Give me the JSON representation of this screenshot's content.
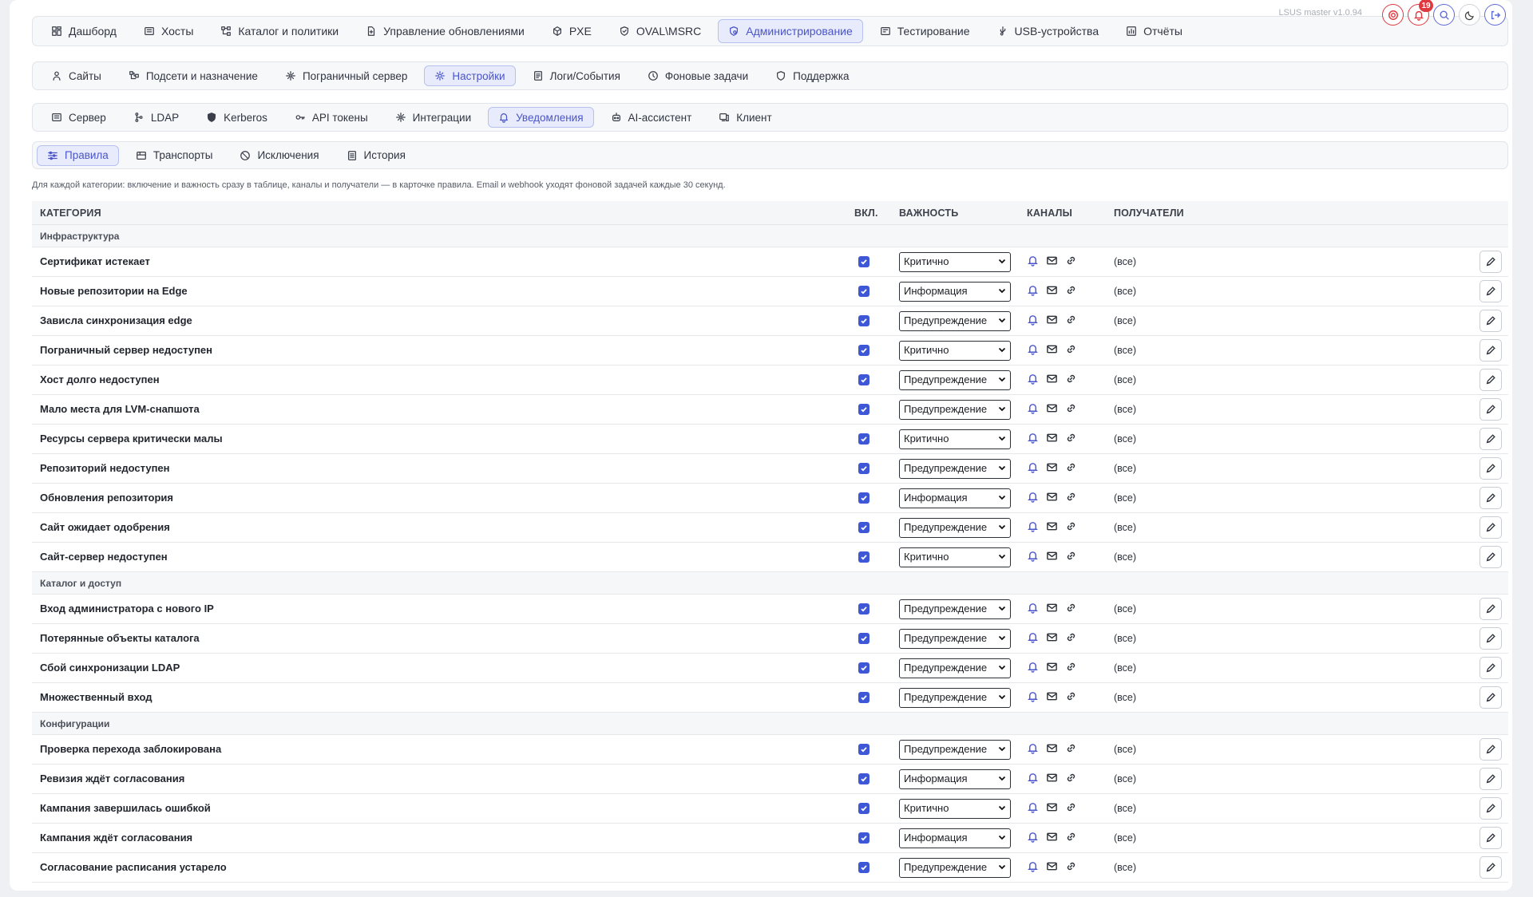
{
  "top_nav": {
    "items": [
      {
        "label": "Дашборд",
        "icon": "dashboard-icon"
      },
      {
        "label": "Хосты",
        "icon": "server-icon"
      },
      {
        "label": "Каталог и политики",
        "icon": "tree-icon"
      },
      {
        "label": "Управление обновлениями",
        "icon": "file-update-icon"
      },
      {
        "label": "PXE",
        "icon": "box-icon"
      },
      {
        "label": "OVAL\\MSRC",
        "icon": "shield-check-icon"
      },
      {
        "label": "Администрирование",
        "icon": "admin-icon",
        "active": true
      },
      {
        "label": "Тестирование",
        "icon": "test-icon"
      },
      {
        "label": "USB-устройства",
        "icon": "usb-icon"
      },
      {
        "label": "Отчёты",
        "icon": "report-icon"
      }
    ],
    "version": "LSUS master v1.0.94",
    "notifications_badge": "19"
  },
  "admin_tabs": {
    "items": [
      {
        "label": "Сайты",
        "icon": "sites-icon"
      },
      {
        "label": "Подсети и назначение",
        "icon": "subnet-icon"
      },
      {
        "label": "Пограничный сервер",
        "icon": "edge-icon"
      },
      {
        "label": "Настройки",
        "icon": "settings-icon",
        "active": true
      },
      {
        "label": "Логи/События",
        "icon": "logs-icon"
      },
      {
        "label": "Фоновые задачи",
        "icon": "clock-icon"
      },
      {
        "label": "Поддержка",
        "icon": "support-icon"
      }
    ]
  },
  "settings_tabs": {
    "items": [
      {
        "label": "Сервер",
        "icon": "server-icon"
      },
      {
        "label": "LDAP",
        "icon": "ldap-icon"
      },
      {
        "label": "Kerberos",
        "icon": "kerberos-icon"
      },
      {
        "label": "API токены",
        "icon": "key-icon"
      },
      {
        "label": "Интеграции",
        "icon": "integrations-icon"
      },
      {
        "label": "Уведомления",
        "icon": "bell-icon",
        "active": true
      },
      {
        "label": "AI-ассистент",
        "icon": "robot-icon"
      },
      {
        "label": "Клиент",
        "icon": "client-icon"
      }
    ]
  },
  "notif_tabs": {
    "items": [
      {
        "label": "Правила",
        "icon": "rules-icon",
        "active": true
      },
      {
        "label": "Транспорты",
        "icon": "transport-icon"
      },
      {
        "label": "Исключения",
        "icon": "ban-icon"
      },
      {
        "label": "История",
        "icon": "history-icon"
      }
    ]
  },
  "hint": "Для каждой категории: включение и важность сразу в таблице, каналы и получатели — в карточке правила. Email и webhook уходят фоновой задачей каждые 30 секунд.",
  "table": {
    "headers": {
      "category": "КАТЕГОРИЯ",
      "enabled": "ВКЛ.",
      "severity": "ВАЖНОСТЬ",
      "channels": "КАНАЛЫ",
      "recipients": "ПОЛУЧАТЕЛИ"
    },
    "groups": [
      {
        "name": "Инфраструктура",
        "rows": [
          {
            "name": "Сертификат истекает",
            "enabled": true,
            "severity": "Критично",
            "recipients": "(все)"
          },
          {
            "name": "Новые репозитории на Edge",
            "enabled": true,
            "severity": "Информация",
            "recipients": "(все)"
          },
          {
            "name": "Зависла синхронизация edge",
            "enabled": true,
            "severity": "Предупреждение",
            "recipients": "(все)"
          },
          {
            "name": "Пограничный сервер недоступен",
            "enabled": true,
            "severity": "Критично",
            "recipients": "(все)"
          },
          {
            "name": "Хост долго недоступен",
            "enabled": true,
            "severity": "Предупреждение",
            "recipients": "(все)"
          },
          {
            "name": "Мало места для LVM-снапшота",
            "enabled": true,
            "severity": "Предупреждение",
            "recipients": "(все)"
          },
          {
            "name": "Ресурсы сервера критически малы",
            "enabled": true,
            "severity": "Критично",
            "recipients": "(все)"
          },
          {
            "name": "Репозиторий недоступен",
            "enabled": true,
            "severity": "Предупреждение",
            "recipients": "(все)"
          },
          {
            "name": "Обновления репозитория",
            "enabled": true,
            "severity": "Информация",
            "recipients": "(все)"
          },
          {
            "name": "Сайт ожидает одобрения",
            "enabled": true,
            "severity": "Предупреждение",
            "recipients": "(все)"
          },
          {
            "name": "Сайт-сервер недоступен",
            "enabled": true,
            "severity": "Критично",
            "recipients": "(все)"
          }
        ]
      },
      {
        "name": "Каталог и доступ",
        "rows": [
          {
            "name": "Вход администратора с нового IP",
            "enabled": true,
            "severity": "Предупреждение",
            "recipients": "(все)"
          },
          {
            "name": "Потерянные объекты каталога",
            "enabled": true,
            "severity": "Предупреждение",
            "recipients": "(все)"
          },
          {
            "name": "Сбой синхронизации LDAP",
            "enabled": true,
            "severity": "Предупреждение",
            "recipients": "(все)"
          },
          {
            "name": "Множественный вход",
            "enabled": true,
            "severity": "Предупреждение",
            "recipients": "(все)"
          }
        ]
      },
      {
        "name": "Конфигурации",
        "rows": [
          {
            "name": "Проверка перехода заблокирована",
            "enabled": true,
            "severity": "Предупреждение",
            "recipients": "(все)"
          },
          {
            "name": "Ревизия ждёт согласования",
            "enabled": true,
            "severity": "Информация",
            "recipients": "(все)"
          },
          {
            "name": "Кампания завершилась ошибкой",
            "enabled": true,
            "severity": "Критично",
            "recipients": "(все)"
          },
          {
            "name": "Кампания ждёт согласования",
            "enabled": true,
            "severity": "Информация",
            "recipients": "(все)"
          },
          {
            "name": "Согласование расписания устарело",
            "enabled": true,
            "severity": "Предупреждение",
            "recipients": "(все)"
          }
        ]
      }
    ]
  },
  "colors": {
    "accent": "#4a55c8",
    "checkbox": "#3d57d6",
    "danger": "#e0383f"
  }
}
